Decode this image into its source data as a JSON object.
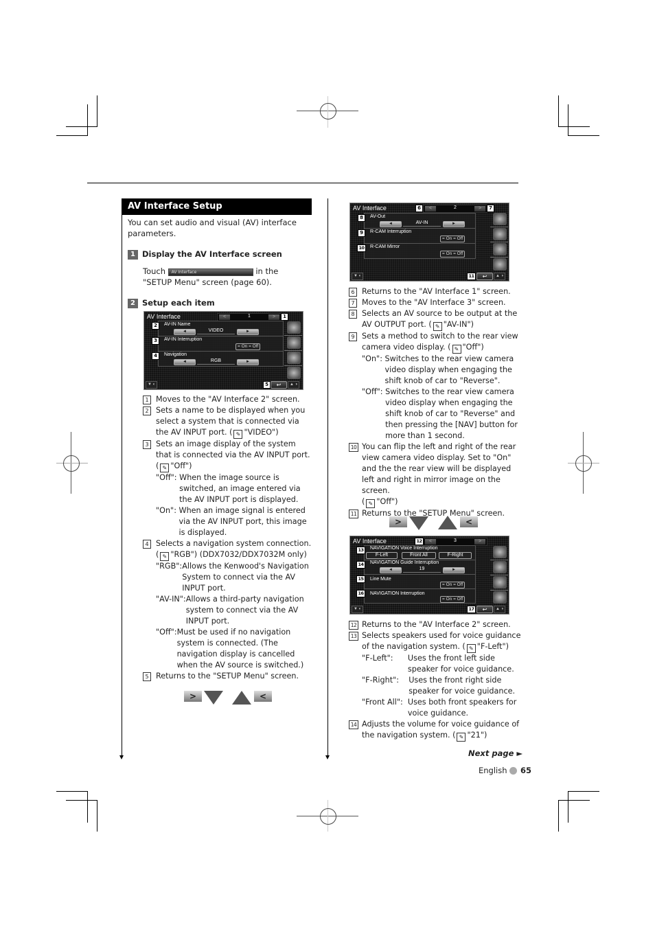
{
  "section": {
    "title": "AV Interface Setup",
    "intro": "You can set audio and visual (AV) interface parameters."
  },
  "steps": [
    {
      "number": "1",
      "title": "Display the AV Interface screen",
      "text_before": "Touch",
      "button_label": "AV Interface",
      "text_after": "in the \"SETUP Menu\" screen (page 60)."
    },
    {
      "number": "2",
      "title": "Setup each item"
    }
  ],
  "screens": [
    {
      "title": "AV Interface",
      "page": "1",
      "prev_arrow": "<",
      "next_arrow": ">",
      "rows": [
        {
          "callout": "2",
          "label": "AV-IN Name",
          "type": "selector",
          "left": "◄",
          "value": "VIDEO",
          "right": "►"
        },
        {
          "callout": "3",
          "label": "AV-IN Interruption",
          "type": "onoff",
          "value": "= On  = Off"
        },
        {
          "callout": "4",
          "label": "Navigation",
          "type": "selector",
          "left": "◄",
          "value": "RGB",
          "right": "►"
        }
      ],
      "callouts": {
        "next": "1",
        "return": "5"
      },
      "bottom_left": "▼ ◐",
      "bottom_right": "▲ ◑",
      "return_icon": "↩"
    },
    {
      "title": "AV Interface",
      "page": "2",
      "prev_arrow": "<",
      "next_arrow": ">",
      "rows": [
        {
          "callout": "8",
          "label": "AV-Out",
          "type": "selector",
          "left": "◄",
          "value": "AV-IN",
          "right": "►"
        },
        {
          "callout": "9",
          "label": "R-CAM Interruption",
          "type": "onoff",
          "value": "= On  = Off"
        },
        {
          "callout": "10",
          "label": "R-CAM Mirror",
          "type": "onoff",
          "value": "= On  = Off"
        }
      ],
      "callouts": {
        "prev": "6",
        "next": "7",
        "return": "11"
      },
      "bottom_left": "▼ ◐",
      "bottom_right": "▲ ◑",
      "return_icon": "↩"
    },
    {
      "title": "AV Interface",
      "page": "3",
      "prev_arrow": "<",
      "next_arrow": ">",
      "rows": [
        {
          "callout": "13",
          "label": "NAVIGATION Voice Interruption",
          "type": "options",
          "options": [
            "F-Left",
            "Front All",
            "F-Right"
          ]
        },
        {
          "callout": "14",
          "label": "NAVIGATION Guide Interruption",
          "type": "selector",
          "left": "◄",
          "value": "19",
          "right": "►"
        },
        {
          "callout": "15",
          "label": "Line Mute",
          "type": "onoff",
          "value": "= On  = Off"
        },
        {
          "callout": "16",
          "label": "NAVIGATION Interruption",
          "type": "onoff",
          "value": "= On  = Off"
        }
      ],
      "callouts": {
        "prev": "12",
        "return": "17"
      },
      "bottom_left": "▼ ◐",
      "bottom_right": "▲ ◑",
      "return_icon": "↩"
    }
  ],
  "nav_strip": {
    "next_glyph": ">",
    "prev_glyph": "<"
  },
  "items_left": [
    {
      "n": "1",
      "text": "Moves to the \"AV Interface 2\" screen."
    },
    {
      "n": "2",
      "text": "Sets a name to be displayed when you select a system that is connected via the AV INPUT port. (",
      "default": "\"VIDEO\")"
    },
    {
      "n": "3",
      "text": "Sets an image display of the system that is connected via the AV INPUT port.",
      "default_line": "\"Off\")",
      "subs": [
        {
          "k": "\"Off\": ",
          "v": "When the image source is switched, an image entered via the AV INPUT port is displayed."
        },
        {
          "k": "\"On\": ",
          "v": "When an image signal is entered via the AV INPUT port, this image is displayed."
        }
      ]
    },
    {
      "n": "4",
      "text": "Selects a navigation system connection.",
      "default_line": "\"RGB\") (DDX7032/DDX7032M only)",
      "subs": [
        {
          "k": "\"RGB\":",
          "v": "Allows the Kenwood's Navigation System to connect via the AV INPUT port."
        },
        {
          "k": "\"AV-IN\":",
          "v": "Allows a third-party navigation system to connect via the AV INPUT port."
        },
        {
          "k": "\"Off\":",
          "v": "Must be used if no navigation system is connected. (The navigation display is cancelled when the AV source is switched.)"
        }
      ]
    },
    {
      "n": "5",
      "text": "Returns to the \"SETUP Menu\" screen."
    }
  ],
  "items_right_a": [
    {
      "n": "6",
      "text": "Returns to the \"AV Interface 1\" screen."
    },
    {
      "n": "7",
      "text": "Moves to the \"AV Interface 3\" screen."
    },
    {
      "n": "8",
      "text": "Selects an AV source to be output at the AV OUTPUT port. (",
      "default": "\"AV-IN\")"
    },
    {
      "n": "9",
      "text": "Sets a method to switch to the rear view camera video display. (",
      "default": "\"Off\")",
      "subs": [
        {
          "k": "\"On\": ",
          "v": "Switches to the rear view camera video display when engaging the shift knob of car to \"Reverse\"."
        },
        {
          "k": "\"Off\": ",
          "v": "Switches to the rear view camera video display when engaging the shift knob of car to \"Reverse\" and then pressing the [NAV] button for more than 1 second."
        }
      ]
    },
    {
      "n": "10",
      "text": "You can flip the left and right of the rear view camera video display. Set to \"On\" and the the rear view will be displayed left and right in mirror image on the screen.",
      "default_line": "\"Off\")"
    },
    {
      "n": "11",
      "text": "Returns to the \"SETUP Menu\" screen."
    }
  ],
  "items_right_b": [
    {
      "n": "12",
      "text": "Returns to the \"AV Interface 2\" screen."
    },
    {
      "n": "13",
      "text": "Selects speakers used for voice guidance of the navigation system. (",
      "default": "\"F-Left\")",
      "subs": [
        {
          "k": "\"F-Left\":      ",
          "v": "Uses the front left side speaker for voice guidance."
        },
        {
          "k": "\"F-Right\":    ",
          "v": "Uses the front right side speaker for voice guidance."
        },
        {
          "k": "\"Front All\":  ",
          "v": "Uses both front speakers for voice guidance."
        }
      ]
    },
    {
      "n": "14",
      "text": "Adjusts the volume for voice guidance of the navigation system. (",
      "default": "\"21\")"
    }
  ],
  "icons": {
    "pen": "✎"
  },
  "footer": {
    "next_page": "Next page ►",
    "language": "English",
    "page_number": "65"
  }
}
